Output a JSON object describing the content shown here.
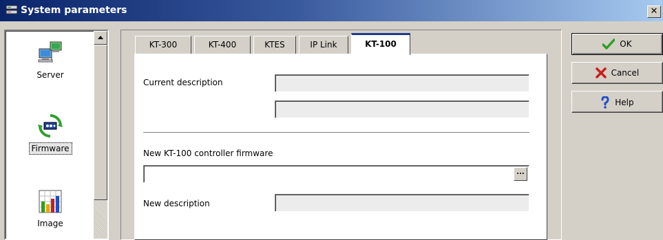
{
  "window": {
    "title": "System parameters",
    "close_glyph": "✕"
  },
  "sidebar": {
    "items": [
      {
        "label": "Server",
        "icon": "server-icon",
        "selected": false
      },
      {
        "label": "Firmware",
        "icon": "firmware-icon",
        "selected": true
      },
      {
        "label": "Image",
        "icon": "image-chart-icon",
        "selected": false
      }
    ]
  },
  "tabs": [
    {
      "label": "KT-300",
      "active": false
    },
    {
      "label": "KT-400",
      "active": false
    },
    {
      "label": "KTES",
      "active": false
    },
    {
      "label": "IP Link",
      "active": false
    },
    {
      "label": "KT-100",
      "active": true
    }
  ],
  "form": {
    "current_description_label": "Current description",
    "current_description_value_1": "",
    "current_description_value_2": "",
    "new_firmware_label": "New KT-100 controller firmware",
    "new_firmware_value": "",
    "browse_glyph": "...",
    "new_description_label": "New description",
    "new_description_value": ""
  },
  "buttons": {
    "ok": {
      "label": "OK",
      "icon": "checkmark-icon",
      "color": "#2e9e24"
    },
    "cancel": {
      "label": "Cancel",
      "icon": "x-icon",
      "color": "#c81e1e"
    },
    "help": {
      "label": "Help",
      "icon": "question-icon",
      "color": "#1e4ec8"
    }
  },
  "colors": {
    "title_start": "#0a246a",
    "title_end": "#a6caf0",
    "face": "#d4d0c8"
  }
}
